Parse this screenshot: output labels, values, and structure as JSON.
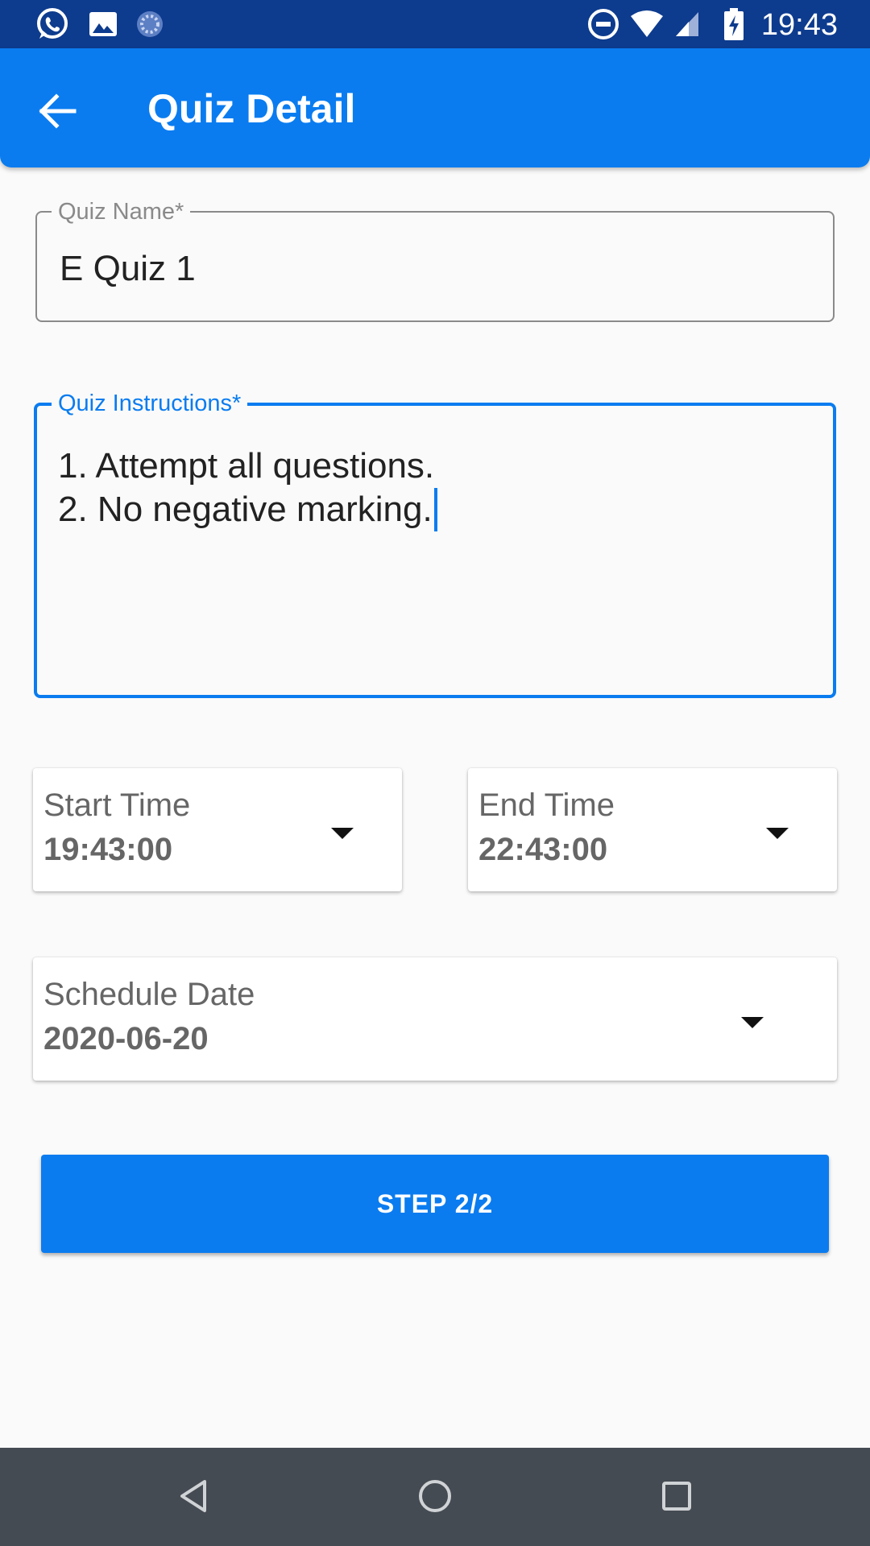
{
  "status_bar": {
    "time": "19:43",
    "left_icons": [
      "whatsapp-icon",
      "image-icon",
      "loading-spinner-icon"
    ],
    "right_icons": [
      "do-not-disturb-icon",
      "wifi-icon",
      "cell-signal-icon",
      "battery-charging-icon"
    ]
  },
  "app_bar": {
    "title": "Quiz Detail",
    "back_icon": "arrow-back-icon",
    "color": "#0a7cf0"
  },
  "form": {
    "quiz_name": {
      "label": "Quiz Name*",
      "value": "E Quiz 1"
    },
    "quiz_instructions": {
      "label": "Quiz Instructions*",
      "lines": [
        "1. Attempt all questions.",
        "2. No negative marking."
      ]
    },
    "start_time": {
      "label": "Start Time",
      "value": "19:43:00"
    },
    "end_time": {
      "label": "End Time",
      "value": "22:43:00"
    },
    "schedule_date": {
      "label": "Schedule Date",
      "value": "2020-06-20"
    }
  },
  "step_button": {
    "label": "STEP 2/2"
  },
  "nav_bar": {
    "icons": [
      "nav-back-icon",
      "nav-home-icon",
      "nav-recents-icon"
    ]
  }
}
